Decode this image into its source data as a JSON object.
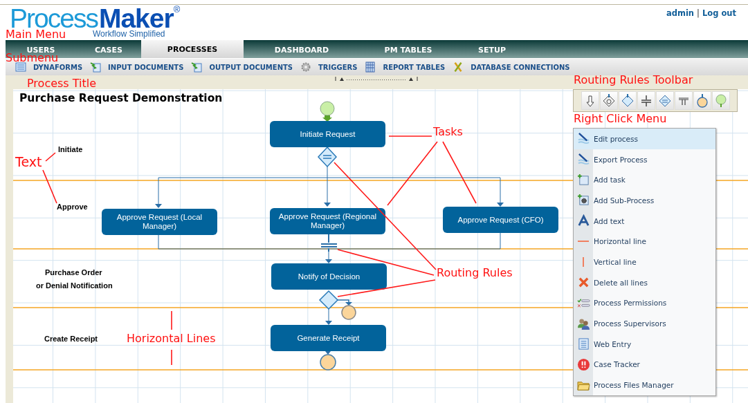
{
  "header": {
    "logo": {
      "light": "Process",
      "bold": "Maker",
      "mark": "®",
      "tagline": "Workflow Simplified"
    },
    "user": "admin",
    "separator": "|",
    "logout": "Log out"
  },
  "main_menu": [
    {
      "label": "USERS",
      "selected": false
    },
    {
      "label": "CASES",
      "selected": false
    },
    {
      "label": "PROCESSES",
      "selected": true
    },
    {
      "label": "DASHBOARD",
      "selected": false
    },
    {
      "label": "PM TABLES",
      "selected": false
    },
    {
      "label": "SETUP",
      "selected": false
    }
  ],
  "submenu": [
    {
      "label": "DYNAFORMS"
    },
    {
      "label": "INPUT DOCUMENTS"
    },
    {
      "label": "OUTPUT DOCUMENTS"
    },
    {
      "label": "TRIGGERS"
    },
    {
      "label": "REPORT TABLES"
    },
    {
      "label": "DATABASE CONNECTIONS"
    }
  ],
  "process": {
    "title": "Purchase Request Demonstration",
    "texts": [
      "Initiate",
      "Approve",
      "Purchase Order",
      "or Denial Notification",
      "Create Receipt"
    ],
    "tasks": [
      {
        "label": "Initiate Request"
      },
      {
        "label": "Approve Request (Local Manager)"
      },
      {
        "label": "Approve Request (Regional Manager)"
      },
      {
        "label": "Approve Request (CFO)"
      },
      {
        "label": "Notify of Decision"
      },
      {
        "label": "Generate Receipt"
      }
    ]
  },
  "context_menu": [
    {
      "label": "Edit process",
      "selected": true
    },
    {
      "label": "Export Process",
      "selected": false
    },
    {
      "label": "Add task",
      "selected": false
    },
    {
      "label": "Add Sub-Process",
      "selected": false
    },
    {
      "label": "Add text",
      "selected": false
    },
    {
      "label": "Horizontal line",
      "selected": false
    },
    {
      "label": "Vertical line",
      "selected": false
    },
    {
      "label": "Delete all lines",
      "selected": false
    },
    {
      "label": "Process Permissions",
      "selected": false
    },
    {
      "label": "Process Supervisors",
      "selected": false
    },
    {
      "label": "Web Entry",
      "selected": false
    },
    {
      "label": "Case Tracker",
      "selected": false
    },
    {
      "label": "Process Files Manager",
      "selected": false
    }
  ],
  "annotations": [
    "Main Menu",
    "Submenu",
    "Process Title",
    "Routing Rules Toolbar",
    "Right Click Menu",
    "Text",
    "Tasks",
    "Routing Rules",
    "Horizontal Lines"
  ]
}
